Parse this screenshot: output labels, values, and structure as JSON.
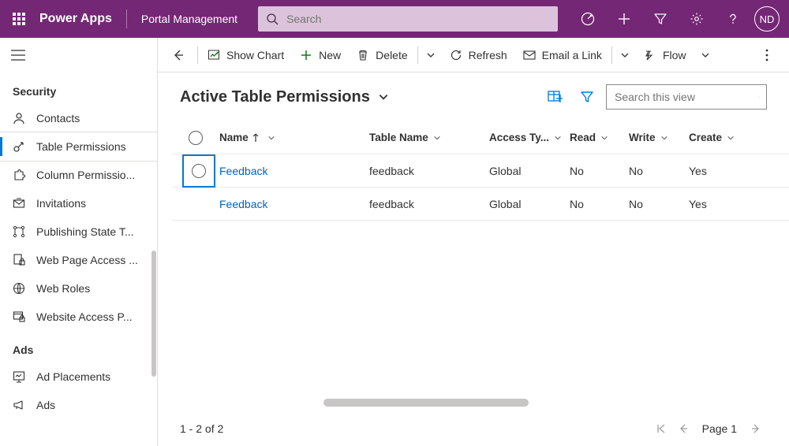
{
  "header": {
    "app_name": "Power Apps",
    "portal_name": "Portal Management",
    "search_placeholder": "Search",
    "avatar_initials": "ND"
  },
  "sidebar": {
    "sections": [
      {
        "label": "Security",
        "items": [
          {
            "id": "contacts",
            "label": "Contacts"
          },
          {
            "id": "table-permissions",
            "label": "Table Permissions",
            "selected": true
          },
          {
            "id": "column-permissions",
            "label": "Column Permissio..."
          },
          {
            "id": "invitations",
            "label": "Invitations"
          },
          {
            "id": "publishing-state",
            "label": "Publishing State T..."
          },
          {
            "id": "web-page-access",
            "label": "Web Page Access ..."
          },
          {
            "id": "web-roles",
            "label": "Web Roles"
          },
          {
            "id": "website-access",
            "label": "Website Access P..."
          }
        ]
      },
      {
        "label": "Ads",
        "items": [
          {
            "id": "ad-placements",
            "label": "Ad Placements"
          },
          {
            "id": "ads",
            "label": "Ads"
          }
        ]
      }
    ]
  },
  "commandBar": {
    "back": "Back",
    "show_chart": "Show Chart",
    "new": "New",
    "delete": "Delete",
    "refresh": "Refresh",
    "email_link": "Email a Link",
    "flow": "Flow"
  },
  "view": {
    "title": "Active Table Permissions",
    "search_placeholder": "Search this view"
  },
  "table": {
    "columns": {
      "name": "Name",
      "table_name": "Table Name",
      "access_type": "Access Ty...",
      "read": "Read",
      "write": "Write",
      "create": "Create"
    },
    "rows": [
      {
        "name": "Feedback",
        "table_name": "feedback",
        "access_type": "Global",
        "read": "No",
        "write": "No",
        "create": "Yes",
        "focused": true
      },
      {
        "name": "Feedback",
        "table_name": "feedback",
        "access_type": "Global",
        "read": "No",
        "write": "No",
        "create": "Yes",
        "focused": false
      }
    ]
  },
  "footer": {
    "range_label": "1 - 2 of 2",
    "page_label": "Page 1"
  }
}
